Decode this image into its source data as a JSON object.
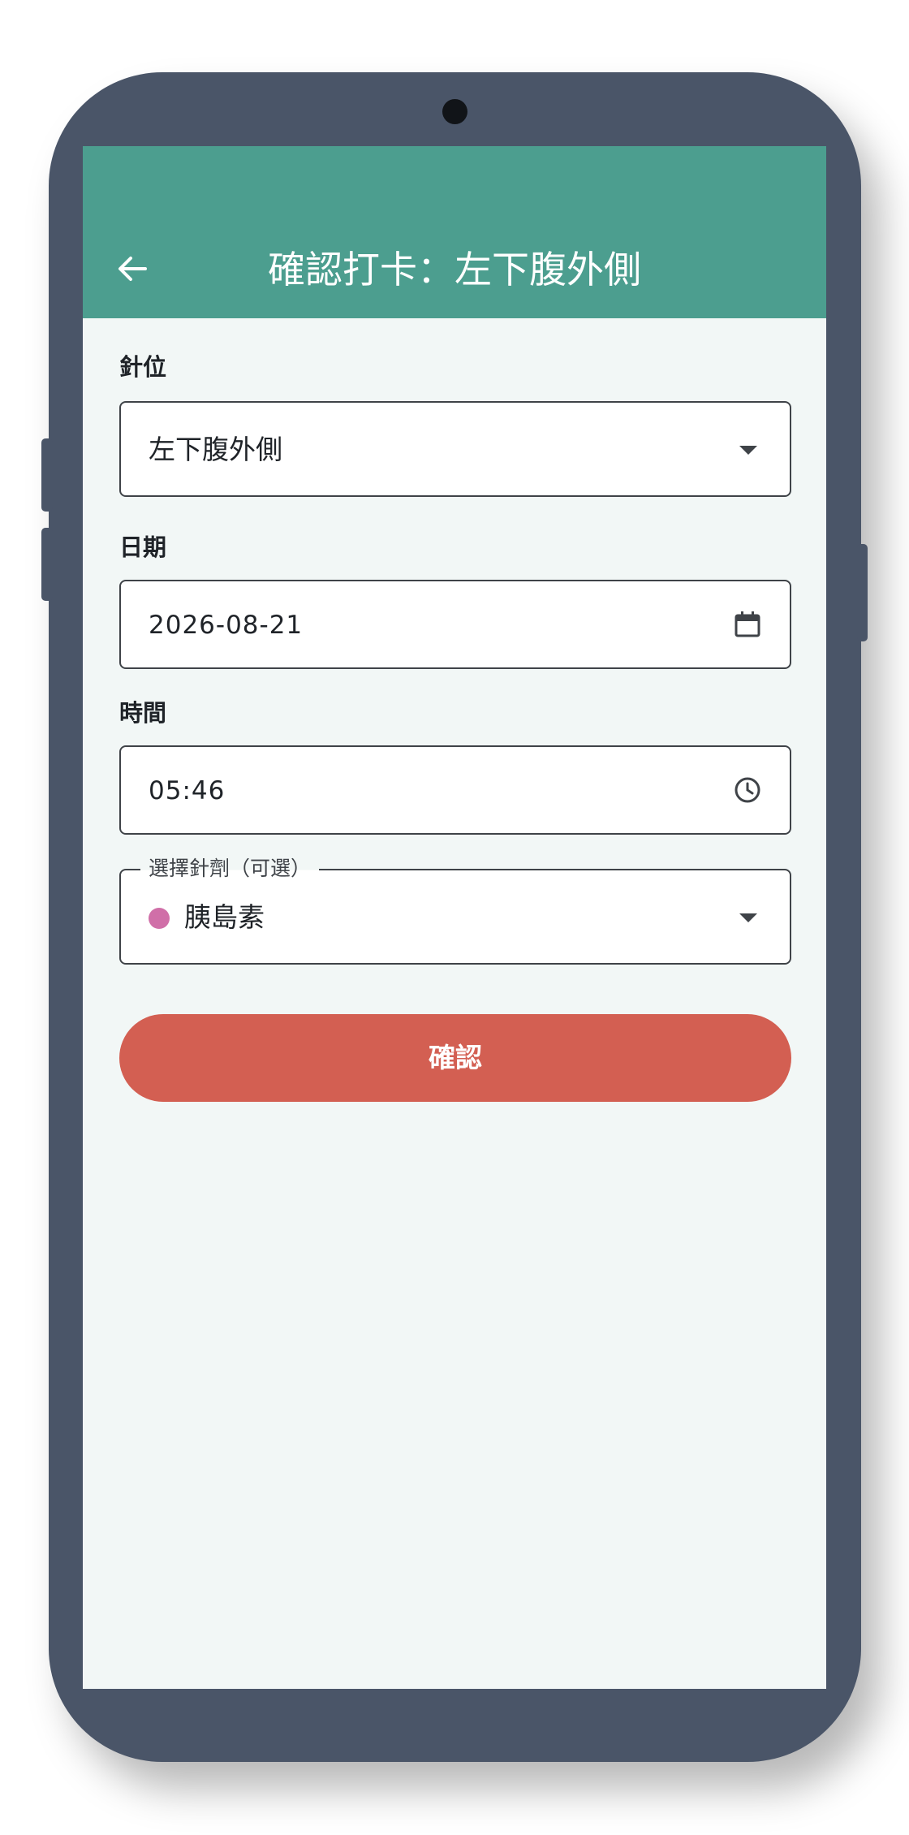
{
  "appbar": {
    "title": "確認打卡：左下腹外側",
    "back_icon": "arrow-left-icon"
  },
  "form": {
    "site": {
      "label": "針位",
      "value": "左下腹外側",
      "icon": "dropdown-caret-icon"
    },
    "date": {
      "label": "日期",
      "value": "2026-08-21",
      "icon": "calendar-icon"
    },
    "time": {
      "label": "時間",
      "value": "05:46",
      "icon": "clock-icon"
    },
    "medication": {
      "label": "選擇針劑（可選）",
      "value": "胰島素",
      "dot_color": "#d06fa8",
      "icon": "dropdown-caret-icon"
    }
  },
  "confirm_label": "確認",
  "colors": {
    "appbar": "#4c9e8f",
    "confirm_button": "#d35f52",
    "screen_background": "#f2f7f6",
    "device_frame": "#4a5568"
  }
}
